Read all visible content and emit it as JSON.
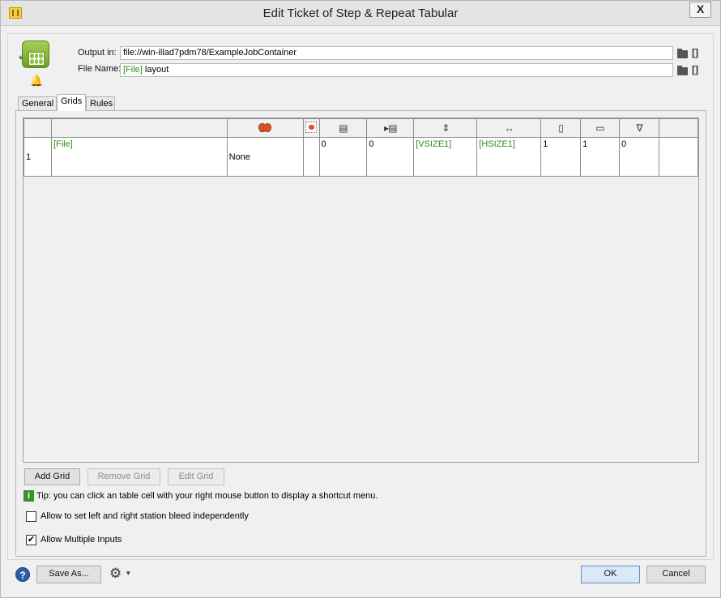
{
  "window": {
    "title": "Edit Ticket of Step & Repeat Tabular",
    "close_label": "X"
  },
  "fields": {
    "output_label": "Output in:",
    "output_value": "file://win-illad7pdm78/ExampleJobContainer",
    "filename_label": "File Name:",
    "filename_token": "[File]",
    "filename_value": "layout",
    "bracket": "[]"
  },
  "tabs": [
    {
      "label": "General"
    },
    {
      "label": "Grids",
      "active": true
    },
    {
      "label": "Rules"
    }
  ],
  "grid_table": {
    "header_icons": [
      "",
      "",
      "mask-icon",
      "small-mask-icon",
      "insert-row-icon",
      "insert-column-icon",
      "vertical-size-icon",
      "horizontal-size-icon",
      "rows-icon",
      "columns-icon",
      "triangle-icon",
      ""
    ],
    "header_glyphs": [
      "",
      "",
      "",
      "",
      "▤",
      "▸▤",
      "⇕",
      "↔",
      "▯",
      "▭",
      "∇",
      ""
    ],
    "rows": [
      [
        "1",
        "[File]",
        "None",
        "",
        "0",
        "0",
        "[VSIZE1]",
        "[HSIZE1]",
        "1",
        "1",
        "0",
        ""
      ]
    ]
  },
  "buttons": {
    "add_grid": "Add Grid",
    "remove_grid": "Remove Grid",
    "edit_grid": "Edit Grid",
    "save_as": "Save As...",
    "ok": "OK",
    "cancel": "Cancel"
  },
  "tip": {
    "icon": "i",
    "text": "Tip: you can click an table cell with your right mouse button to display a shortcut menu."
  },
  "options": {
    "bleed_label": "Allow to set left and right station bleed independently",
    "bleed_checked": false,
    "multiple_label": "Allow Multiple Inputs",
    "multiple_checked": true
  },
  "footer": {
    "help_icon": "?",
    "gear_glyph": "⚙",
    "gear_arrow": "▾"
  },
  "colors": {
    "token_green": "#2f8a1b",
    "mask_red": "#d9532b",
    "tip_green": "#3c8f2a",
    "help_blue": "#2d5fa8"
  }
}
